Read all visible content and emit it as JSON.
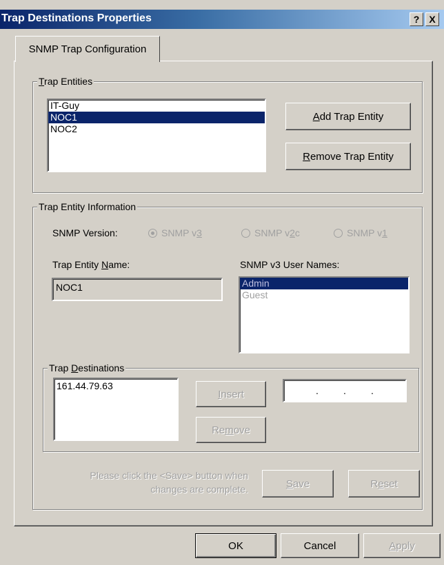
{
  "window": {
    "title": "Trap Destinations Properties",
    "help_button": "?",
    "close_button": "X"
  },
  "tabs": [
    {
      "label": "SNMP Trap Configuration",
      "active": true
    }
  ],
  "trap_entities": {
    "group_label": "Trap Entities",
    "items": [
      "IT-Guy",
      "NOC1",
      "NOC2"
    ],
    "selected": "NOC1",
    "add_button": "Add Trap Entity",
    "remove_button": "Remove Trap Entity"
  },
  "trap_entity_info": {
    "group_label": "Trap Entity Information",
    "snmp_version_label": "SNMP Version:",
    "versions": [
      {
        "label": "SNMP v3",
        "checked": true
      },
      {
        "label": "SNMP v2c",
        "checked": false
      },
      {
        "label": "SNMP v1",
        "checked": false
      }
    ],
    "entity_name_label": "Trap Entity Name:",
    "entity_name_value": "NOC1",
    "user_names_label": "SNMP v3 User Names:",
    "user_names": [
      "Admin",
      "Guest"
    ],
    "selected_user": "Admin"
  },
  "trap_destinations": {
    "group_label": "Trap Destinations",
    "items": [
      "161.44.79.63"
    ],
    "insert_button": "Insert",
    "remove_button": "Remove",
    "ip_input_separators": [
      ".",
      ".",
      "."
    ]
  },
  "footer": {
    "message_line1": "Please click the <Save> button when",
    "message_line2": "changes are complete.",
    "save_button": "Save",
    "reset_button": "Reset"
  },
  "dialog_buttons": {
    "ok": "OK",
    "cancel": "Cancel",
    "apply": "Apply"
  },
  "colors": {
    "selection": "#0a246a",
    "face": "#d4d0c8",
    "disabled_text": "#a0a0a0"
  }
}
